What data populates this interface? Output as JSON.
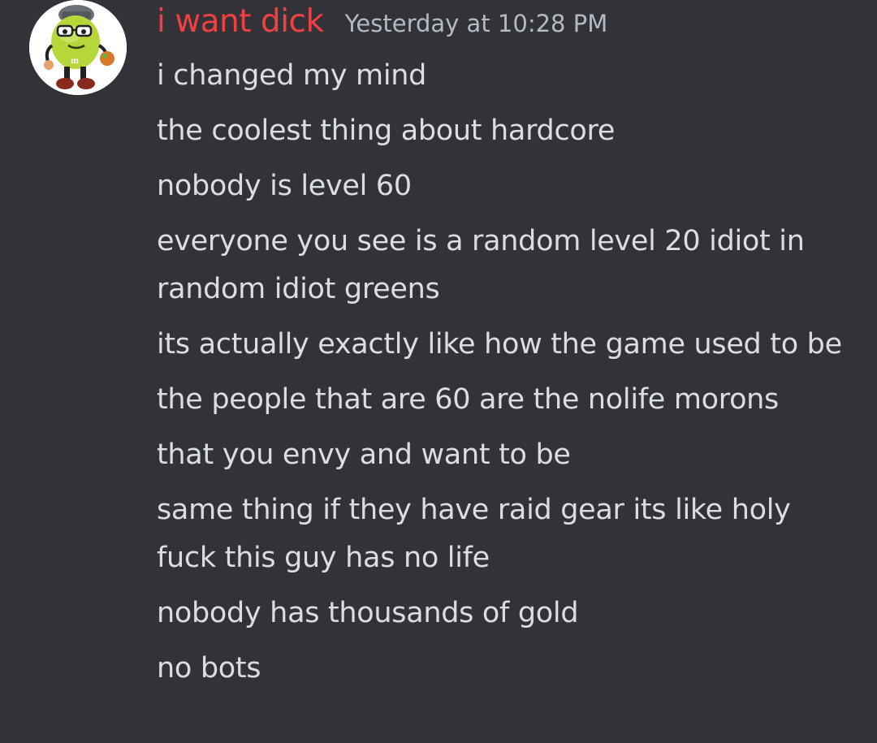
{
  "message_group": {
    "author": {
      "name": "i want dick",
      "name_color": "#f23f42",
      "avatar_icon": "green-mm-character-avatar"
    },
    "timestamp": "Yesterday at 10:28 PM",
    "messages": [
      "i changed my mind",
      "the coolest thing about hardcore",
      "nobody is level 60",
      "everyone you see is a random level 20 idiot in random idiot greens",
      "its actually exactly like how the game used to be",
      "the people that are 60 are the nolife morons",
      "that you envy and want to be",
      "same thing if they have raid gear its like holy fuck this guy has no life",
      "nobody has thousands of gold",
      "no bots"
    ]
  },
  "colors": {
    "background": "#313338",
    "message_text": "#dbdee1",
    "timestamp_text": "#b5bac1"
  }
}
